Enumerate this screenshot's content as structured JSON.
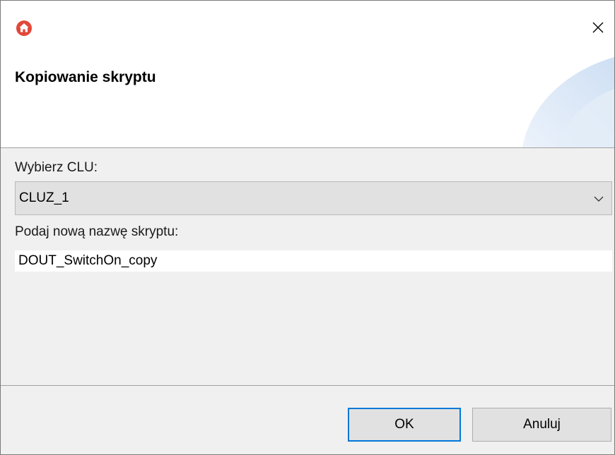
{
  "window": {
    "title": "Kopiowanie skryptu",
    "app_icon": "home-icon",
    "close_icon": "close-icon"
  },
  "form": {
    "clu_label": "Wybierz CLU:",
    "clu_selected": "CLUZ_1",
    "name_label": "Podaj nową nazwę skryptu:",
    "name_value": "DOUT_SwitchOn_copy"
  },
  "buttons": {
    "ok_label": "OK",
    "cancel_label": "Anuluj"
  },
  "colors": {
    "app_icon": "#e2483a",
    "focus_border": "#0078d7",
    "deco_blue": "#dbe7f5"
  }
}
